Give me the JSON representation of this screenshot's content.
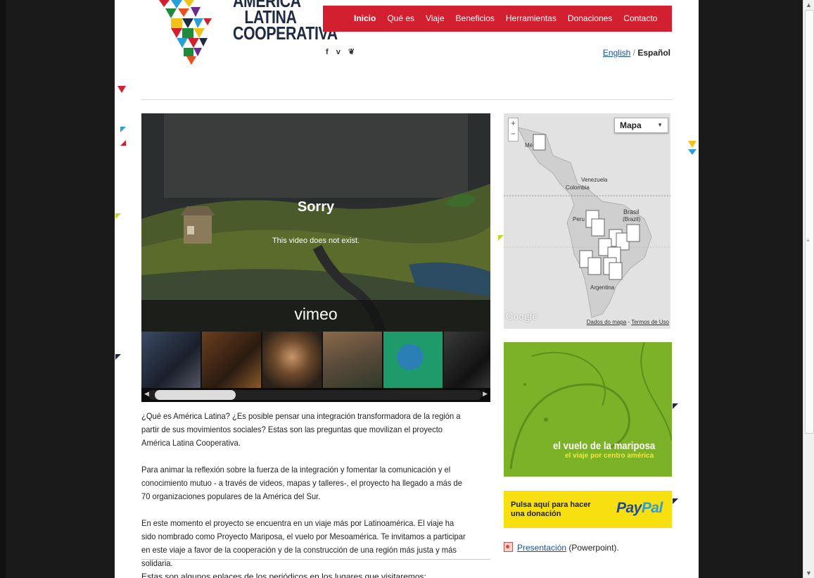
{
  "logo": {
    "lines": [
      "AMERICA",
      "LATINA",
      "COOPERATIVA"
    ]
  },
  "nav": {
    "items": [
      "Inicio",
      "Qué es",
      "Viaje",
      "Beneficios",
      "Herramientas",
      "Donaciones",
      "Contacto"
    ]
  },
  "social": {
    "icons": "f v ❦"
  },
  "lang": {
    "english": "English",
    "sep": "/",
    "spanish": "Español"
  },
  "video": {
    "error_title": "Sorry",
    "error_msg": "This video does not exist.",
    "brand": "vimeo"
  },
  "map": {
    "type_label": "Mapa",
    "labels": {
      "mexico": "Mé",
      "venezuela": "Venezuela",
      "colombia": "Colombia",
      "brasil": "Brasil",
      "brasil2": "(Brazil)",
      "peru": "Peru",
      "argentina": "Argentina"
    },
    "google": "Google",
    "attrib_data": "Dados do mapa",
    "attrib_sep": " - ",
    "attrib_terms": "Termos de Uso"
  },
  "banner": {
    "title": "el vuelo de la mariposa",
    "subtitle": "el viaje por centro américa"
  },
  "paypal": {
    "label": "Pulsa aquí para hacer una donación",
    "logo_pay": "Pay",
    "logo_pal": "Pal"
  },
  "presentation": {
    "link": "Presentación",
    "suffix": " (Powerpoint)."
  },
  "body": {
    "p1": "¿Qué es América Latina? ¿Es posible pensar una integración transformadora de la región a partir de sus movimientos sociales? Estas son las preguntas que movilizan el proyecto América Latina Cooperativa.",
    "p2": "Para animar la reflexión sobre la fuerza de la integración y fomentar la comunicación y el conocimiento mutuo - a través de videos, mapas y talleres-, el proyecto ha llegado a más de 70 organizaciones populares de la América del Sur.",
    "p3": "En este momento el proyecto se encuentra en un viaje más por Latinoamérica. El viaje ha sido nombrado como Proyecto Mariposa, el vuelo por Mesoamérica. Te invitamos a participar en este viaje a favor de la cooperación y de la construcción de una región más justa y más solidaria.",
    "cut": "Estas son algunos enlaces de los periódicos en los lugares que visitaremos:"
  },
  "colors": {
    "nav_red": "#d32030",
    "banner_green": "#7bb227",
    "paypal_yellow": "#f7df10",
    "link_blue": "#1a4fa0"
  }
}
